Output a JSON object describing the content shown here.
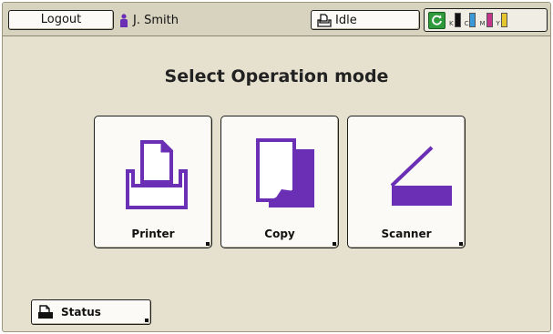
{
  "header": {
    "logout_label": "Logout",
    "user_name": "J. Smith",
    "device_status": "Idle"
  },
  "toner": [
    {
      "label": "K",
      "color": "#111111"
    },
    {
      "label": "C",
      "color": "#3a9ad9"
    },
    {
      "label": "M",
      "color": "#c2378b"
    },
    {
      "label": "Y",
      "color": "#e6c62d"
    }
  ],
  "main": {
    "title": "Select Operation mode",
    "modes": [
      {
        "label": "Printer",
        "icon": "printer-icon"
      },
      {
        "label": "Copy",
        "icon": "copy-icon"
      },
      {
        "label": "Scanner",
        "icon": "scanner-icon"
      }
    ]
  },
  "footer": {
    "status_label": "Status"
  },
  "colors": {
    "accent": "#6a2fb5",
    "background": "#e6e1cf"
  }
}
